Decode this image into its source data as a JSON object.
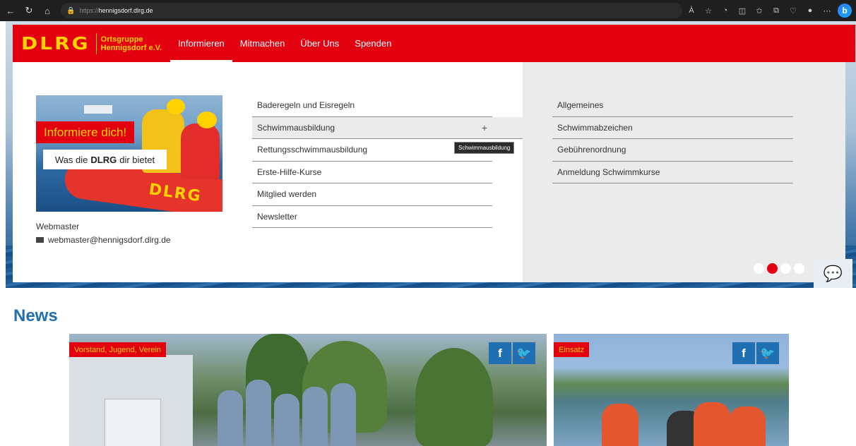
{
  "browser": {
    "url_protocol": "https://",
    "url_host": "hennigsdorf.dlrg.de",
    "nav_icons": [
      "back-icon",
      "refresh-icon",
      "home-icon"
    ],
    "tool_icons": [
      "read-aloud-icon",
      "favorite-star-icon",
      "extension-icon",
      "split-screen-icon",
      "favorites-icon",
      "collections-icon",
      "browser-essentials-icon",
      "profile-icon",
      "more-icon",
      "copilot-icon"
    ],
    "read_aloud": "À",
    "copilot_label": "b"
  },
  "header": {
    "logo_text": "DLRG",
    "org_line1": "Ortsgruppe",
    "org_line2": "Hennigsdorf e.V.",
    "menu": [
      {
        "label": "Informieren"
      },
      {
        "label": "Mitmachen"
      },
      {
        "label": "Über Uns"
      },
      {
        "label": "Spenden"
      }
    ],
    "brand_color": "#e3000f",
    "accent_color": "#ffd200"
  },
  "mega_menu": {
    "promo": {
      "headline": "Informiere dich!",
      "sub_prefix": "Was die",
      "sub_brand": "DLRG",
      "sub_suffix": "dir bietet",
      "boat_text": "DLRG"
    },
    "contact": {
      "role": "Webmaster",
      "email": "webmaster@hennigsdorf.dlrg.de"
    },
    "items": [
      {
        "label": "Baderegeln und Eisregeln"
      },
      {
        "label": "Schwimmausbildung",
        "expand": "+"
      },
      {
        "label": "Rettungsschwimmausbildung"
      },
      {
        "label": "Erste-Hilfe-Kurse"
      },
      {
        "label": "Mitglied werden"
      },
      {
        "label": "Newsletter"
      }
    ],
    "tooltip": "Schwimmausbildung",
    "sub_items": [
      {
        "label": "Allgemeines"
      },
      {
        "label": "Schwimmabzeichen"
      },
      {
        "label": "Gebührenordnung"
      },
      {
        "label": "Anmeldung Schwimmkurse"
      }
    ]
  },
  "slider": {
    "dots": 4,
    "active_dot": 2
  },
  "news": {
    "title": "News",
    "cards": [
      {
        "category": "Vorstand, Jugend, Verein",
        "facebook": "f",
        "twitter": "🐦"
      },
      {
        "category": "Einsatz",
        "facebook": "f",
        "twitter": "🐦"
      }
    ]
  }
}
